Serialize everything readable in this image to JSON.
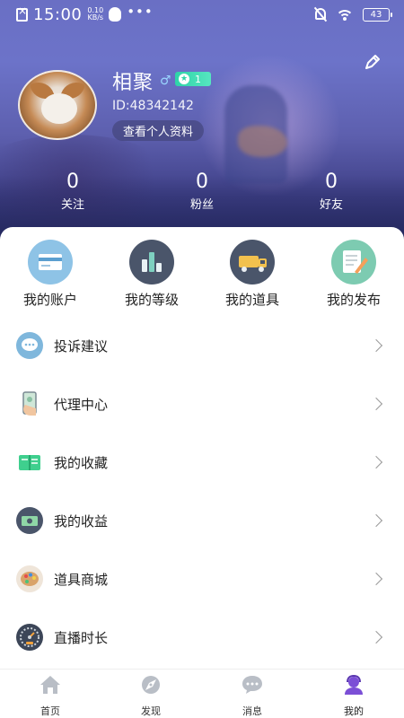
{
  "status_bar": {
    "time": "15:00",
    "speed_value": "0.10",
    "speed_unit": "KB/s",
    "dots": "•••",
    "battery": "43"
  },
  "profile": {
    "nickname": "相聚",
    "gender_symbol": "♂",
    "level": "1",
    "user_id": "ID:48342142",
    "view_profile_label": "查看个人资料"
  },
  "stats": [
    {
      "value": "0",
      "label": "关注"
    },
    {
      "value": "0",
      "label": "粉丝"
    },
    {
      "value": "0",
      "label": "好友"
    }
  ],
  "shortcuts": [
    {
      "label": "我的账户",
      "icon": "card-icon",
      "color": "#78b4e0"
    },
    {
      "label": "我的等级",
      "icon": "bar-chart-icon",
      "color": "#4a556a"
    },
    {
      "label": "我的道具",
      "icon": "truck-icon",
      "color": "#4a556a"
    },
    {
      "label": "我的发布",
      "icon": "notepad-pen-icon",
      "color": "#7dcbb1"
    }
  ],
  "menu": [
    {
      "label": "投诉建议",
      "icon": "chat-bubble-icon"
    },
    {
      "label": "代理中心",
      "icon": "phone-hand-icon"
    },
    {
      "label": "我的收藏",
      "icon": "book-icon"
    },
    {
      "label": "我的收益",
      "icon": "cash-icon"
    },
    {
      "label": "道具商城",
      "icon": "palette-icon"
    },
    {
      "label": "直播时长",
      "icon": "speedometer-icon"
    }
  ],
  "bottom_nav": [
    {
      "label": "首页",
      "icon": "home-icon",
      "active": false
    },
    {
      "label": "发现",
      "icon": "discover-icon",
      "active": false
    },
    {
      "label": "消息",
      "icon": "message-icon",
      "active": false
    },
    {
      "label": "我的",
      "icon": "profile-icon",
      "active": true
    }
  ],
  "colors": {
    "accent": "#7b4fd6",
    "badge_green": "#2fd3a8",
    "nav_icon_gray": "#b9bec6"
  }
}
